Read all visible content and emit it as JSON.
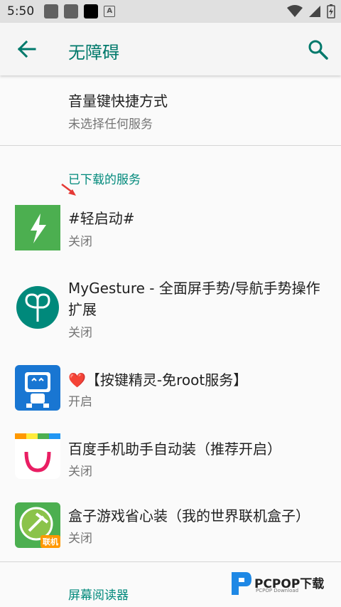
{
  "status_bar": {
    "time": "5:50",
    "a_badge": "A"
  },
  "app_bar": {
    "title": "无障碍",
    "back_icon": "arrow-back-icon",
    "search_icon": "search-icon"
  },
  "shortcut": {
    "title": "音量键快捷方式",
    "subtitle": "未选择任何服务"
  },
  "downloaded_section": {
    "header": "已下载的服务"
  },
  "services": [
    {
      "title": "#轻启动#",
      "status": "关闭",
      "icon": "lightning-icon"
    },
    {
      "title": "MyGesture - 全面屏手势/导航手势操作扩展",
      "status": "关闭",
      "icon": "gesture-icon"
    },
    {
      "title": "❤️【按键精灵-免root服务】",
      "status": "开启",
      "icon": "robot-icon"
    },
    {
      "title": "百度手机助手自动装（推荐开启）",
      "status": "关闭",
      "icon": "baidu-bag-icon"
    },
    {
      "title": "盒子游戏省心装（我的世界联机盒子）",
      "status": "关闭",
      "icon": "minecraft-box-icon",
      "badge": "联机"
    }
  ],
  "screen_reader_section": {
    "header": "屏幕阅读器"
  },
  "watermark": {
    "brand": "PCPOP下载",
    "sub": "PCPOP Download"
  },
  "colors": {
    "accent": "#00796b",
    "status_bar": "#e0e0e0",
    "background": "#fafafa"
  }
}
